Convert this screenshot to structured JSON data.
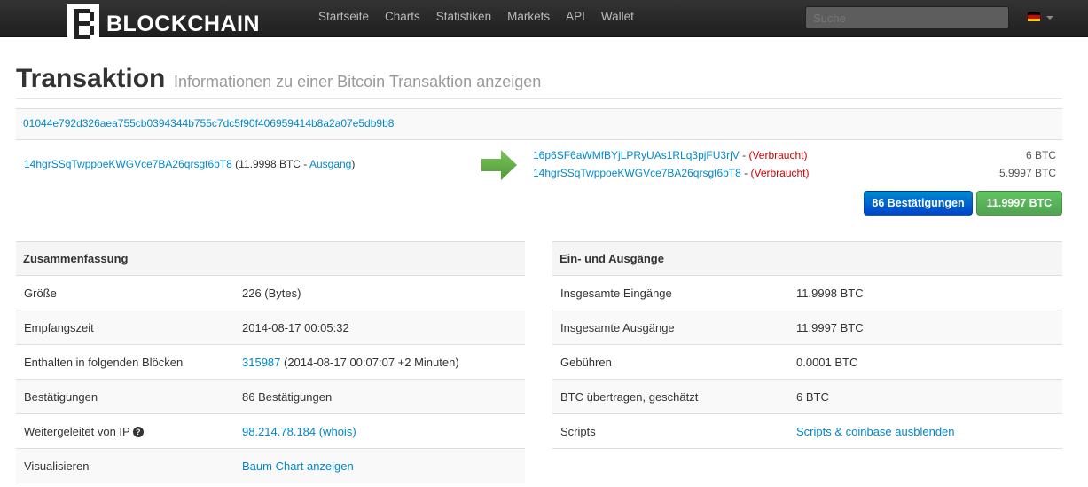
{
  "navbar": {
    "brand": "BLOCKCHAIN",
    "links": [
      "Startseite",
      "Charts",
      "Statistiken",
      "Markets",
      "API",
      "Wallet"
    ],
    "search_placeholder": "Suche",
    "flag_icon": "german-flag-icon"
  },
  "page": {
    "title": "Transaktion",
    "subtitle": "Informationen zu einer Bitcoin Transaktion anzeigen"
  },
  "transaction": {
    "hash": "01044e792d326aea755cb0394344b755c7dc5f90f406959414b8a2a07e5db9b8",
    "input": {
      "address": "14hgrSSqTwppoeKWGVce7BA26qrsgt6bT8",
      "amount": "(11.9998 BTC - ",
      "type": "Ausgang",
      "close": ")"
    },
    "outputs": [
      {
        "address": "16p6SF6aWMfBYjLPRyUAs1RLq3pjFU3rjV",
        "sep": " - ",
        "status": "(Verbraucht)",
        "amount": "6 BTC"
      },
      {
        "address": "14hgrSSqTwppoeKWGVce7BA26qrsgt6bT8",
        "sep": " - ",
        "status": "(Verbraucht)",
        "amount": "5.9997 BTC"
      }
    ],
    "confirmations_button": "86 Bestätigungen",
    "total_button": "11.9997 BTC"
  },
  "summary": {
    "header": "Zusammenfassung",
    "rows": [
      {
        "label": "Größe",
        "value": "226 (Bytes)"
      },
      {
        "label": "Empfangszeit",
        "value": "2014-08-17 00:05:32"
      },
      {
        "label": "Enthalten in folgenden Blöcken",
        "link": "315987",
        "value": " (2014-08-17 00:07:07 +2 Minuten)"
      },
      {
        "label": "Bestätigungen",
        "value": "86 Bestätigungen"
      },
      {
        "label": "Weitergeleitet von IP",
        "link": "98.214.78.184 (whois)"
      },
      {
        "label": "Visualisieren",
        "link": "Baum Chart anzeigen"
      }
    ]
  },
  "io": {
    "header": "Ein- und Ausgänge",
    "rows": [
      {
        "label": "Insgesamte Eingänge",
        "value": "11.9998 BTC"
      },
      {
        "label": "Insgesamte Ausgänge",
        "value": "11.9997 BTC"
      },
      {
        "label": "Gebühren",
        "value": "0.0001 BTC"
      },
      {
        "label": "BTC übertragen, geschätzt",
        "value": "6 BTC"
      },
      {
        "label": "Scripts",
        "link": "Scripts & coinbase ausblenden"
      }
    ]
  },
  "colors": {
    "link": "#0088cc",
    "spent": "#cc0000",
    "btn_blue": "#0055cc",
    "btn_green": "#5bb75b"
  }
}
